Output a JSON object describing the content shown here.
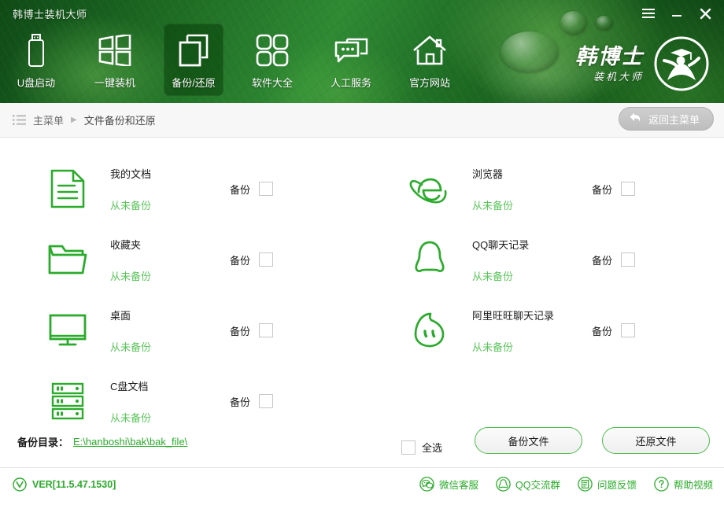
{
  "window": {
    "app_title": "韩博士装机大师",
    "controls": [
      {
        "name": "menu-button",
        "icon": "hamburger-icon",
        "label": "≡"
      },
      {
        "name": "minimize-button",
        "icon": "minimize-icon",
        "label": "–"
      },
      {
        "name": "close-button",
        "icon": "close-icon",
        "label": "✕"
      }
    ]
  },
  "brand": {
    "logo_main": "韩博士",
    "logo_sub": "装机大师",
    "logo_mark": "graduate-person-logo-icon"
  },
  "nav": {
    "items": [
      {
        "label": "U盘启动",
        "icon": "usb-drive-icon",
        "active": false
      },
      {
        "label": "一键装机",
        "icon": "windows-tiles-icon",
        "active": false
      },
      {
        "label": "备份/还原",
        "icon": "copy-pages-icon",
        "active": true
      },
      {
        "label": "软件大全",
        "icon": "four-rounded-squares-icon",
        "active": false
      },
      {
        "label": "人工服务",
        "icon": "chat-bubbles-icon",
        "active": false
      },
      {
        "label": "官方网站",
        "icon": "home-icon",
        "active": false
      }
    ]
  },
  "breadcrumb": {
    "menu_icon": "list-menu-icon",
    "root": "主菜单",
    "separator": "▶",
    "current": "文件备份和还原",
    "back_button": {
      "label": "返回主菜单",
      "icon": "back-arrow-icon"
    }
  },
  "backup": {
    "check_label": "备份",
    "items": [
      {
        "title": "我的文档",
        "status": "从未备份",
        "icon": "document-icon",
        "checked": false
      },
      {
        "title": "浏览器",
        "status": "从未备份",
        "icon": "ie-browser-icon",
        "checked": false
      },
      {
        "title": "收藏夹",
        "status": "从未备份",
        "icon": "folder-icon",
        "checked": false
      },
      {
        "title": "QQ聊天记录",
        "status": "从未备份",
        "icon": "qq-penguin-icon",
        "checked": false
      },
      {
        "title": "桌面",
        "status": "从未备份",
        "icon": "monitor-icon",
        "checked": false
      },
      {
        "title": "阿里旺旺聊天记录",
        "status": "从未备份",
        "icon": "aliwangwang-icon",
        "checked": false
      },
      {
        "title": "C盘文档",
        "status": "从未备份",
        "icon": "disk-stack-icon",
        "checked": false
      }
    ],
    "select_all": {
      "label": "全选",
      "checked": false
    },
    "directory_label": "备份目录：",
    "directory_path": "E:\\hanboshi\\bak\\bak_file\\",
    "buttons": [
      {
        "label": "备份文件",
        "name": "backup-files-button"
      },
      {
        "label": "还原文件",
        "name": "restore-files-button"
      }
    ]
  },
  "statusbar": {
    "version": "VER[11.5.47.1530]",
    "version_icon": "v-circle-icon",
    "links": [
      {
        "label": "微信客服",
        "icon": "wechat-icon"
      },
      {
        "label": "QQ交流群",
        "icon": "qq-circle-icon"
      },
      {
        "label": "问题反馈",
        "icon": "feedback-doc-icon"
      },
      {
        "label": "帮助视频",
        "icon": "question-mark-icon"
      }
    ]
  },
  "colors": {
    "brand_green": "#2bab2b",
    "status_green": "#5ac55a",
    "header_dark": "#0f4a16",
    "accent_border": "#4cbb4c"
  }
}
